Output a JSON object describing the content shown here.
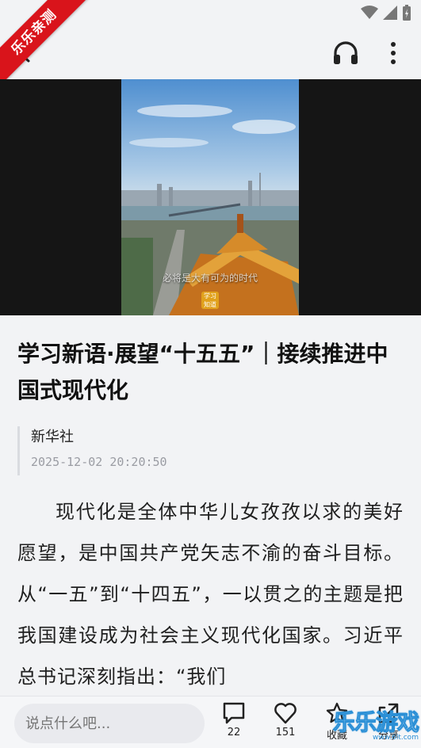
{
  "watermark": {
    "ribbon_text": "乐乐亲测",
    "site_text": "乐乐游戏",
    "site_url": "www.6lt.com"
  },
  "toolbar": {
    "back_icon": "back-arrow-icon",
    "listen_icon": "headphones-icon",
    "more_icon": "more-vertical-icon"
  },
  "video": {
    "caption": "必将是大有可为的时代",
    "logo_text": "学习\n知道"
  },
  "article": {
    "title": "学习新语·展望“十五五”｜接续推进中国式现代化",
    "source": "新华社",
    "timestamp": "2025-12-02 20:20:50",
    "body": "现代化是全体中华儿女孜孜以求的美好愿望，是中国共产党矢志不渝的奋斗目标。从“一五”到“十四五”，一以贯之的主题是把我国建设成为社会主义现代化国家。习近平总书记深刻指出：“我们"
  },
  "bottom": {
    "comment_placeholder": "说点什么吧...",
    "comment_count": "22",
    "like_count": "151",
    "favorite_label": "收藏",
    "share_label": "分享"
  }
}
